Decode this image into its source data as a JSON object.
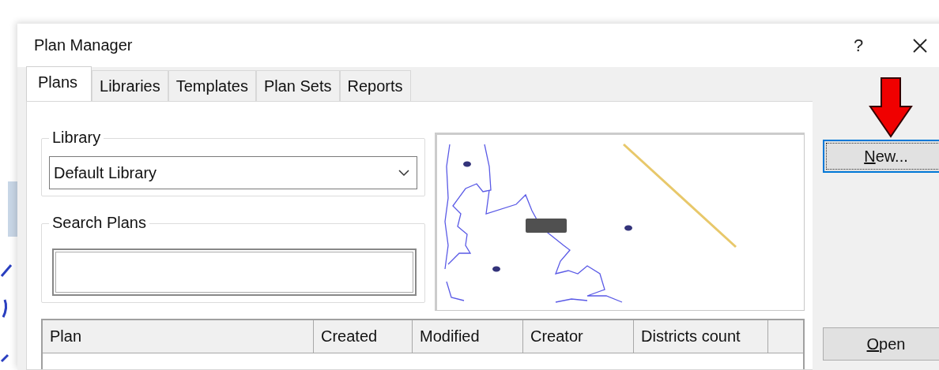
{
  "window": {
    "title": "Plan Manager",
    "help": "?"
  },
  "tabs": [
    {
      "label": "Plans",
      "selected": true
    },
    {
      "label": "Libraries",
      "selected": false
    },
    {
      "label": "Templates",
      "selected": false
    },
    {
      "label": "Plan Sets",
      "selected": false
    },
    {
      "label": "Reports",
      "selected": false
    }
  ],
  "library": {
    "label": "Library",
    "value": "Default Library"
  },
  "search": {
    "label": "Search Plans"
  },
  "buttons": [
    {
      "label": "New...",
      "focused": true
    },
    {
      "label": "Open",
      "focused": false
    }
  ],
  "table": {
    "columns": [
      "Plan",
      "Created",
      "Modified",
      "Creator",
      "Districts count"
    ]
  }
}
